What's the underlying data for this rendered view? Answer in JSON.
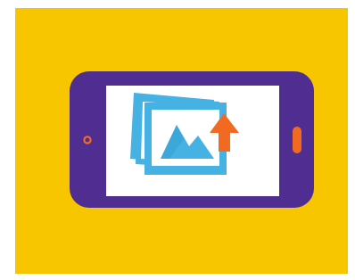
{
  "illustration": {
    "subject": "smartphone-upload-image-icon",
    "colors": {
      "background": "#F7C600",
      "phone_body": "#4F2D91",
      "screen": "#FFFFFF",
      "photo_blue": "#45B2E3",
      "photo_blue_dark": "#2E98CF",
      "arrow_orange": "#F26A21",
      "speaker_orange": "#F26A21",
      "home_button_ring": "#F26A21"
    }
  }
}
